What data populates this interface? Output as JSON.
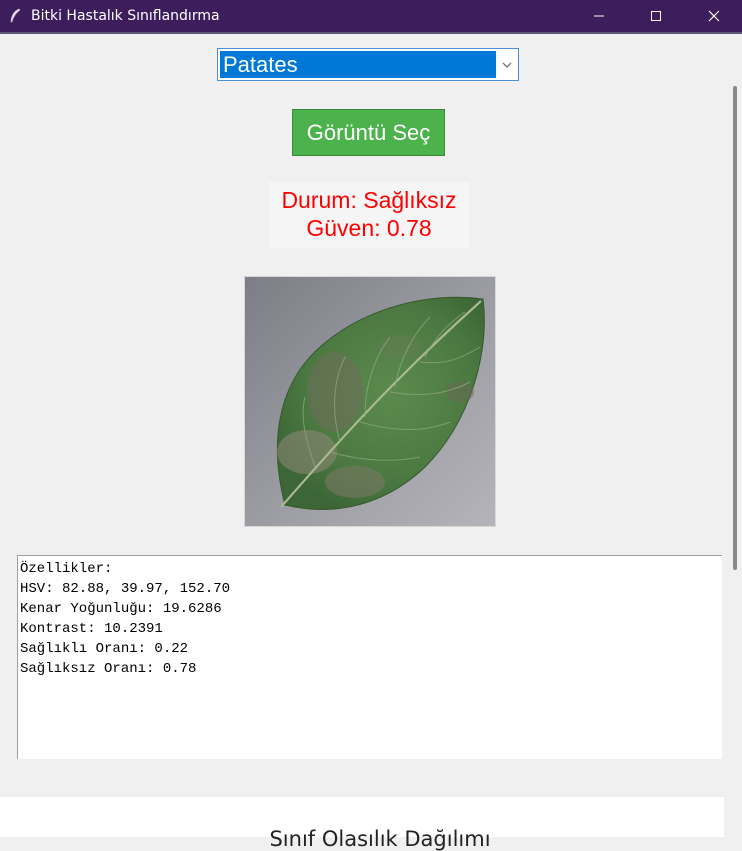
{
  "window": {
    "title": "Bitki Hastalık Sınıflandırma",
    "titlebar_color": "#3d1d5b"
  },
  "combo": {
    "selected": "Patates",
    "highlight_color": "#0078d7"
  },
  "select_button": {
    "label": "Görüntü Seç",
    "color": "#4cb34c"
  },
  "status": {
    "line1": "Durum: Sağlıksız",
    "line2": "Güven: 0.78",
    "color": "#ff0000"
  },
  "image": {
    "subject": "potato leaf"
  },
  "features": {
    "lines": [
      "Özellikler:",
      "HSV: 82.88, 39.97, 152.70",
      "Kenar Yoğunluğu: 19.6286",
      "Kontrast: 10.2391",
      "Sağlıklı Oranı: 0.22",
      "Sağlıksız Oranı: 0.78"
    ]
  },
  "chart": {
    "title": "Sınıf Olasılık Dağılımı"
  }
}
